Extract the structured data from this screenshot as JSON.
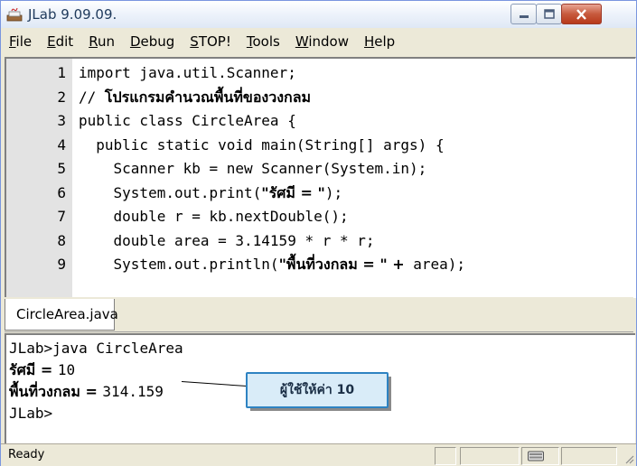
{
  "window": {
    "title": "JLab 9.09.09.",
    "minimize_icon": "minimize-icon",
    "maximize_icon": "maximize-icon",
    "close_icon": "close-icon"
  },
  "menu": {
    "items": [
      "File",
      "Edit",
      "Run",
      "Debug",
      "STOP!",
      "Tools",
      "Window",
      "Help"
    ]
  },
  "editor": {
    "lines": [
      {
        "num": "1",
        "parts": [
          {
            "t": "import java.util.Scanner;"
          }
        ]
      },
      {
        "num": "2",
        "parts": [
          {
            "t": "// "
          },
          {
            "t": "โปรแกรมคำนวณพื้นที่ของวงกลม",
            "th": true
          }
        ]
      },
      {
        "num": "3",
        "parts": [
          {
            "t": "public class CircleArea {"
          }
        ]
      },
      {
        "num": "4",
        "parts": [
          {
            "t": "  public static void main(String[] args) {"
          }
        ]
      },
      {
        "num": "5",
        "parts": [
          {
            "t": "    Scanner kb = new Scanner(System.in);"
          }
        ]
      },
      {
        "num": "6",
        "parts": [
          {
            "t": "    System.out.print("
          },
          {
            "t": "\"รัศมี = \"",
            "th": true
          },
          {
            "t": ");"
          }
        ]
      },
      {
        "num": "7",
        "parts": [
          {
            "t": "    double r = kb.nextDouble();"
          }
        ]
      },
      {
        "num": "8",
        "parts": [
          {
            "t": "    double area = 3.14159 * r * r;"
          }
        ]
      },
      {
        "num": "9",
        "parts": [
          {
            "t": "    System.out.println("
          },
          {
            "t": "\"พื้นที่วงกลม = \" +",
            "th": true
          },
          {
            "t": " area);"
          }
        ]
      }
    ]
  },
  "tab": {
    "label": "CircleArea.java",
    "icon": "java-cup-icon"
  },
  "console": {
    "lines": [
      [
        {
          "t": "JLab>java CircleArea"
        }
      ],
      [
        {
          "t": "รัศมี = ",
          "th": true
        },
        {
          "t": "10"
        }
      ],
      [
        {
          "t": "พื้นที่วงกลม = ",
          "th": true
        },
        {
          "t": "314.159"
        }
      ],
      [
        {
          "t": "JLab>"
        }
      ]
    ]
  },
  "callout": {
    "text": "ผู้ใช้ให้ค่า 10"
  },
  "status": {
    "text": "Ready"
  },
  "colors": {
    "callout_border": "#2e83c2",
    "callout_fill": "#d9ecf8",
    "gutter": "#e3e3e3"
  }
}
